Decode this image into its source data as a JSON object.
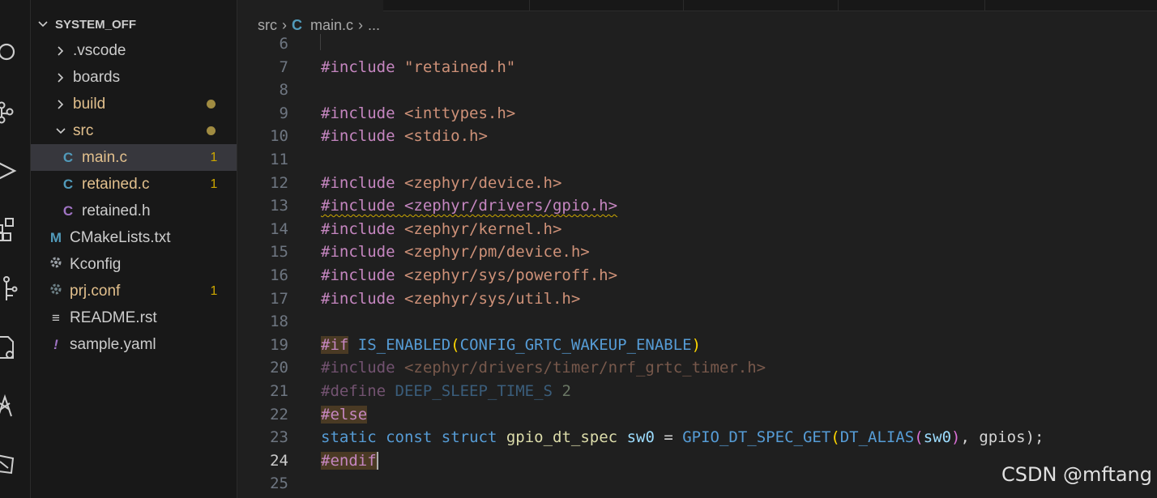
{
  "activity_bar": {
    "icons": [
      "search-icon",
      "source-control-icon",
      "run-debug-icon",
      "extensions-icon",
      "device-tree-icon",
      "board-config-icon",
      "nordic-icon",
      "nrf-connect-icon"
    ]
  },
  "explorer": {
    "folder_name": "SYSTEM_OFF",
    "items": [
      {
        "label": ".vscode"
      },
      {
        "label": "boards"
      },
      {
        "label": "build"
      },
      {
        "label": "src"
      },
      {
        "label": "main.c",
        "icon": "C",
        "badge": "1"
      },
      {
        "label": "retained.c",
        "icon": "C",
        "badge": "1"
      },
      {
        "label": "retained.h",
        "icon": "C"
      },
      {
        "label": "CMakeLists.txt",
        "icon": "M"
      },
      {
        "label": "Kconfig"
      },
      {
        "label": "prj.conf",
        "badge": "1"
      },
      {
        "label": "README.rst",
        "icon": "≡"
      },
      {
        "label": "sample.yaml",
        "icon": "!"
      }
    ]
  },
  "breadcrumb": {
    "folder": "src",
    "file_icon": "C",
    "file": "main.c",
    "more": "..."
  },
  "editor": {
    "active_line": "24",
    "lines": [
      {
        "num": "6",
        "segments": []
      },
      {
        "num": "7",
        "segments": [
          "#include",
          " ",
          "\"retained.h\""
        ]
      },
      {
        "num": "8",
        "segments": []
      },
      {
        "num": "9",
        "segments": [
          "#include",
          " ",
          "<inttypes.h>"
        ]
      },
      {
        "num": "10",
        "segments": [
          "#include",
          " ",
          "<stdio.h>"
        ]
      },
      {
        "num": "11",
        "segments": []
      },
      {
        "num": "12",
        "segments": [
          "#include",
          " ",
          "<zephyr/device.h>"
        ]
      },
      {
        "num": "13",
        "segments": [
          "#include <zephyr/drivers/gpio.h>"
        ]
      },
      {
        "num": "14",
        "segments": [
          "#include",
          " ",
          "<zephyr/kernel.h>"
        ]
      },
      {
        "num": "15",
        "segments": [
          "#include",
          " ",
          "<zephyr/pm/device.h>"
        ]
      },
      {
        "num": "16",
        "segments": [
          "#include",
          " ",
          "<zephyr/sys/poweroff.h>"
        ]
      },
      {
        "num": "17",
        "segments": [
          "#include",
          " ",
          "<zephyr/sys/util.h>"
        ]
      },
      {
        "num": "18",
        "segments": []
      },
      {
        "num": "19",
        "segments": [
          "#if",
          " ",
          "IS_ENABLED",
          "(",
          "CONFIG_GRTC_WAKEUP_ENABLE",
          ")"
        ]
      },
      {
        "num": "20",
        "segments": [
          "#include",
          " ",
          "<zephyr/drivers/timer/nrf_grtc_timer.h>"
        ]
      },
      {
        "num": "21",
        "segments": [
          "#define",
          " ",
          "DEEP_SLEEP_TIME_S",
          " ",
          "2"
        ]
      },
      {
        "num": "22",
        "segments": [
          "#else"
        ]
      },
      {
        "num": "23",
        "segments": [
          "static",
          " ",
          "const",
          " ",
          "struct",
          " ",
          "gpio_dt_spec",
          " ",
          "sw0",
          " = ",
          "GPIO_DT_SPEC_GET",
          "(",
          "DT_ALIAS",
          "(",
          "sw0",
          ")",
          ", ",
          "gpios",
          ");"
        ]
      },
      {
        "num": "24",
        "segments": [
          "#endif"
        ]
      },
      {
        "num": "25",
        "segments": []
      }
    ]
  },
  "watermark": "CSDN @mftang",
  "colors": {
    "editor_bg": "#1f1f1f",
    "sidebar_bg": "#181818",
    "selected_row": "#37373d",
    "modified_text": "#e2c08d",
    "badge": "#cca700",
    "preprocessor": "#c586c0",
    "string": "#ce9178",
    "keyword": "#569cd6",
    "type": "#4ec9b0",
    "variable": "#9cdcfe",
    "function": "#dcdcaa"
  }
}
